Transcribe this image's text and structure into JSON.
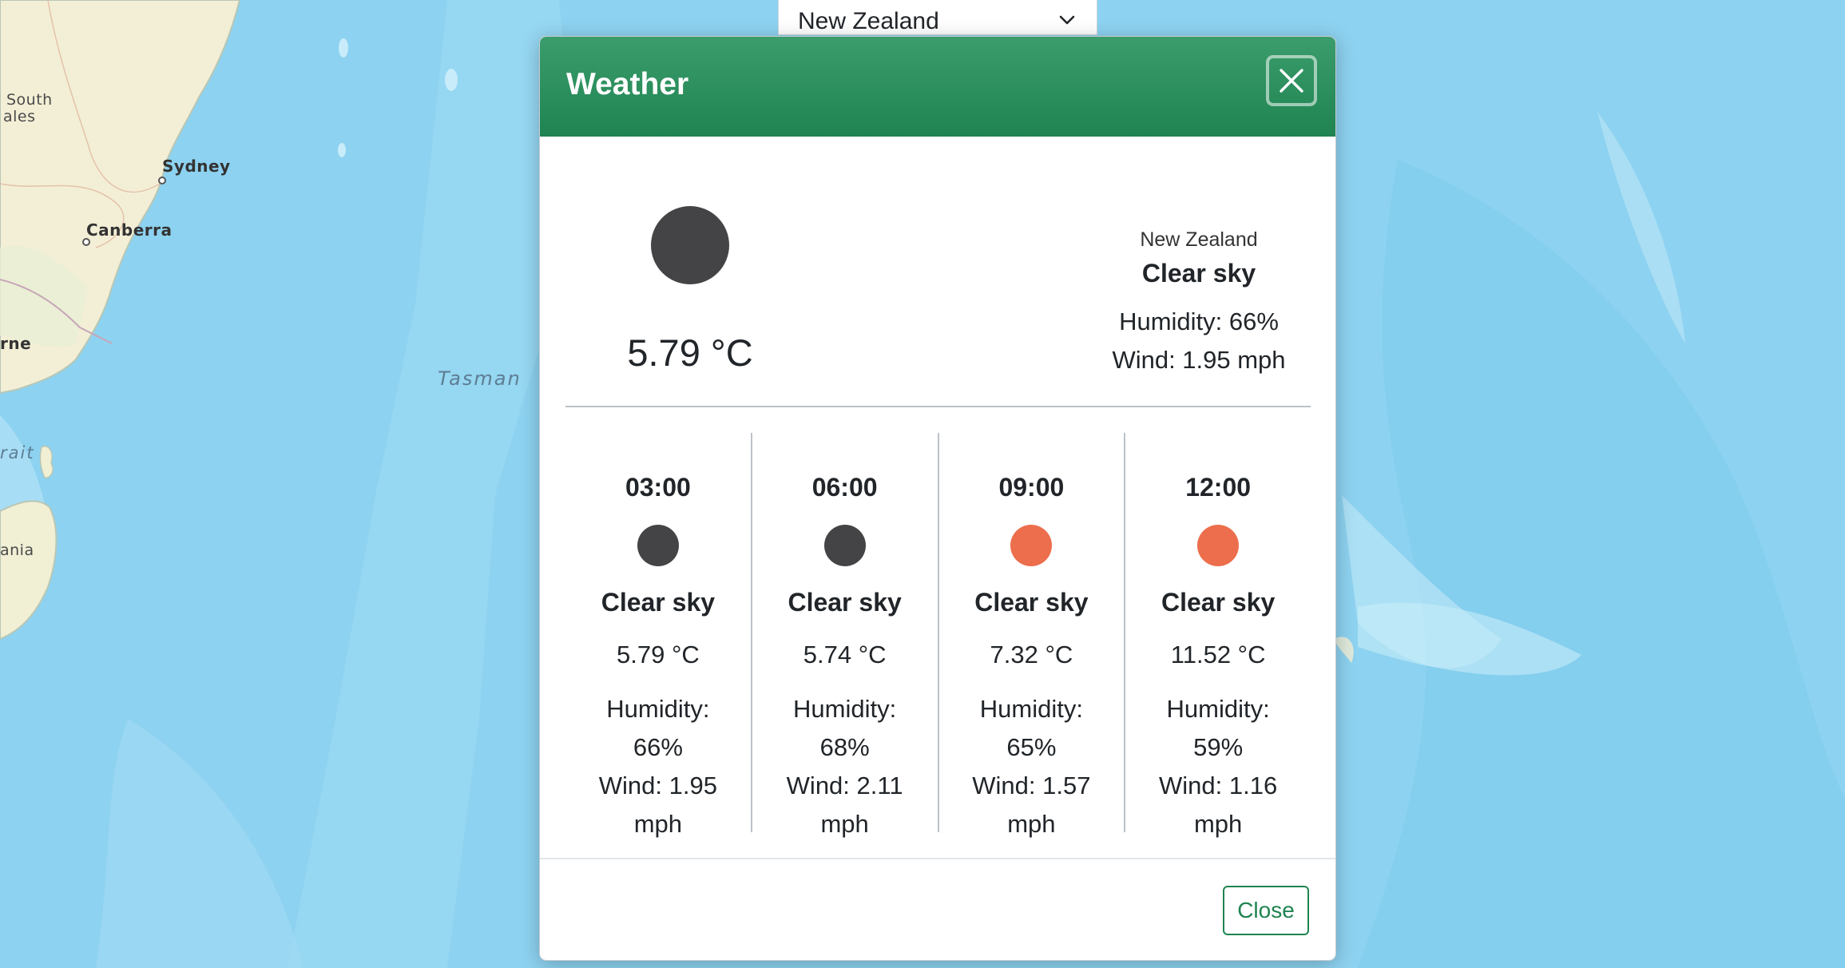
{
  "map": {
    "labels": {
      "south_wales_1": "South",
      "south_wales_2": "ales",
      "sydney": "Sydney",
      "canberra": "Canberra",
      "rne": "rne",
      "tasman": "Tasman",
      "rait": "rait",
      "ania": "ania"
    }
  },
  "country_select": {
    "value": "New Zealand",
    "icon": "chevron-down-icon"
  },
  "modal": {
    "title": "Weather",
    "header_close_icon": "close-icon",
    "current": {
      "location": "New Zealand",
      "description": "Clear sky",
      "temperature": "5.79 °C",
      "humidity": "Humidity: 66%",
      "wind": "Wind: 1.95 mph",
      "icon_color": "#444446"
    },
    "forecast": [
      {
        "time": "03:00",
        "description": "Clear sky",
        "temperature": "5.79 °C",
        "humidity_label": "Humidity:",
        "humidity_value": "66%",
        "wind_label": "Wind: 1.95",
        "wind_unit": "mph",
        "icon_color": "#444446"
      },
      {
        "time": "06:00",
        "description": "Clear sky",
        "temperature": "5.74 °C",
        "humidity_label": "Humidity:",
        "humidity_value": "68%",
        "wind_label": "Wind: 2.11",
        "wind_unit": "mph",
        "icon_color": "#444446"
      },
      {
        "time": "09:00",
        "description": "Clear sky",
        "temperature": "7.32 °C",
        "humidity_label": "Humidity:",
        "humidity_value": "65%",
        "wind_label": "Wind: 1.57",
        "wind_unit": "mph",
        "icon_color": "#ec6e4c"
      },
      {
        "time": "12:00",
        "description": "Clear sky",
        "temperature": "11.52 °C",
        "humidity_label": "Humidity:",
        "humidity_value": "59%",
        "wind_label": "Wind: 1.16",
        "wind_unit": "mph",
        "icon_color": "#ec6e4c"
      }
    ],
    "footer": {
      "close_label": "Close"
    }
  },
  "colors": {
    "header_green": "#1f8451",
    "ocean": "#8fd3f0",
    "land": "#f3efd6"
  }
}
